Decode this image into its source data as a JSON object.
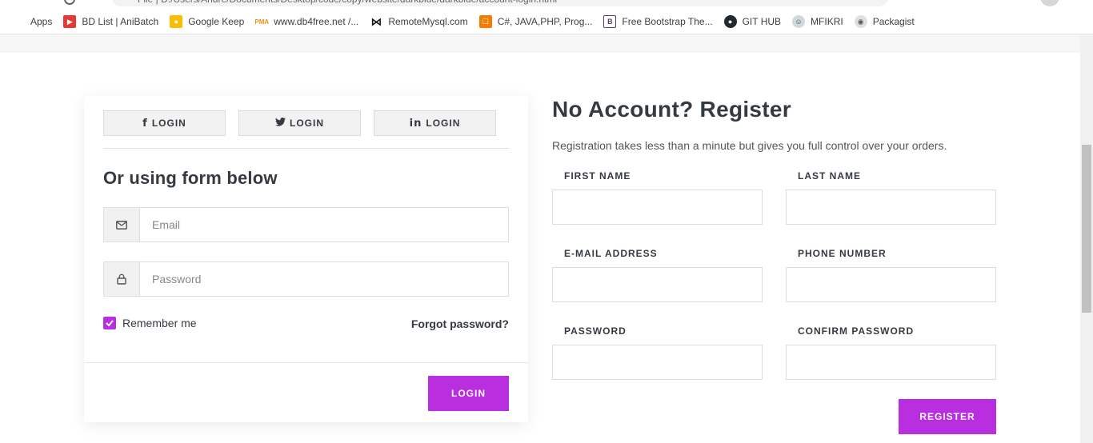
{
  "browser": {
    "url_fragment": "File | D:/Users/Andre/Documents/Desktop/code/copy/website/darkblue/darkblue/account-login.html"
  },
  "bookmarks": [
    {
      "label": "Apps",
      "icon": "apps-grid-icon"
    },
    {
      "label": "BD List | AniBatch",
      "icon": "anibatch-icon"
    },
    {
      "label": "Google Keep",
      "icon": "google-keep-icon"
    },
    {
      "label": "www.db4free.net /...",
      "icon": "phpmyadmin-icon"
    },
    {
      "label": "RemoteMysql.com",
      "icon": "remotemysql-icon"
    },
    {
      "label": "C#, JAVA,PHP, Prog...",
      "icon": "codeproject-icon"
    },
    {
      "label": "Free Bootstrap The...",
      "icon": "bootstrap-icon"
    },
    {
      "label": "GIT HUB",
      "icon": "github-icon"
    },
    {
      "label": "MFIKRI",
      "icon": "mfikri-avatar-icon"
    },
    {
      "label": "Packagist",
      "icon": "packagist-icon"
    }
  ],
  "login": {
    "social": [
      {
        "label": "LOGIN",
        "icon": "facebook-icon"
      },
      {
        "label": "LOGIN",
        "icon": "twitter-icon"
      },
      {
        "label": "LOGIN",
        "icon": "linkedin-icon"
      }
    ],
    "heading": "Or using form below",
    "email_placeholder": "Email",
    "password_placeholder": "Password",
    "remember_label": "Remember me",
    "remember_checked": true,
    "forgot_label": "Forgot password?",
    "submit_label": "LOGIN"
  },
  "register": {
    "title": "No Account? Register",
    "subtitle": "Registration takes less than a minute but gives you full control over your orders.",
    "fields": {
      "first_name": "FIRST NAME",
      "last_name": "LAST NAME",
      "email": "E-MAIL ADDRESS",
      "phone": "PHONE NUMBER",
      "password": "PASSWORD",
      "confirm_password": "CONFIRM PASSWORD"
    },
    "submit_label": "REGISTER"
  },
  "colors": {
    "accent": "#b92fe0",
    "text": "#343a40"
  }
}
